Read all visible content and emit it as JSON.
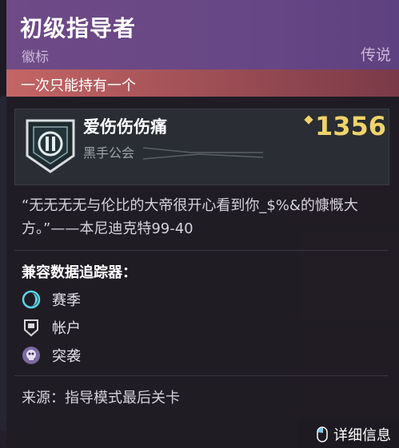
{
  "item": {
    "name": "初级指导者",
    "type": "徽标",
    "rarity": "传说",
    "unique_warning": "一次只能持有一个"
  },
  "banner": {
    "name": "爱伤伤伤痛",
    "clan": "黑手公会",
    "power": "1356"
  },
  "lore": "“无无无无与伦比的大帝很开心看到你_$%&的慷慨大方。”——本尼迪克特99-40",
  "trackers": {
    "title": "兼容数据追踪器：",
    "items": [
      {
        "label": "赛季",
        "icon": "season-icon"
      },
      {
        "label": "帐户",
        "icon": "account-icon"
      },
      {
        "label": "突袭",
        "icon": "raid-icon"
      }
    ]
  },
  "source": "来源：指导模式最后关卡",
  "details_button": "详细信息",
  "colors": {
    "header": "#6e4a86",
    "warning": "#c56565",
    "power": "#f0d36a"
  }
}
